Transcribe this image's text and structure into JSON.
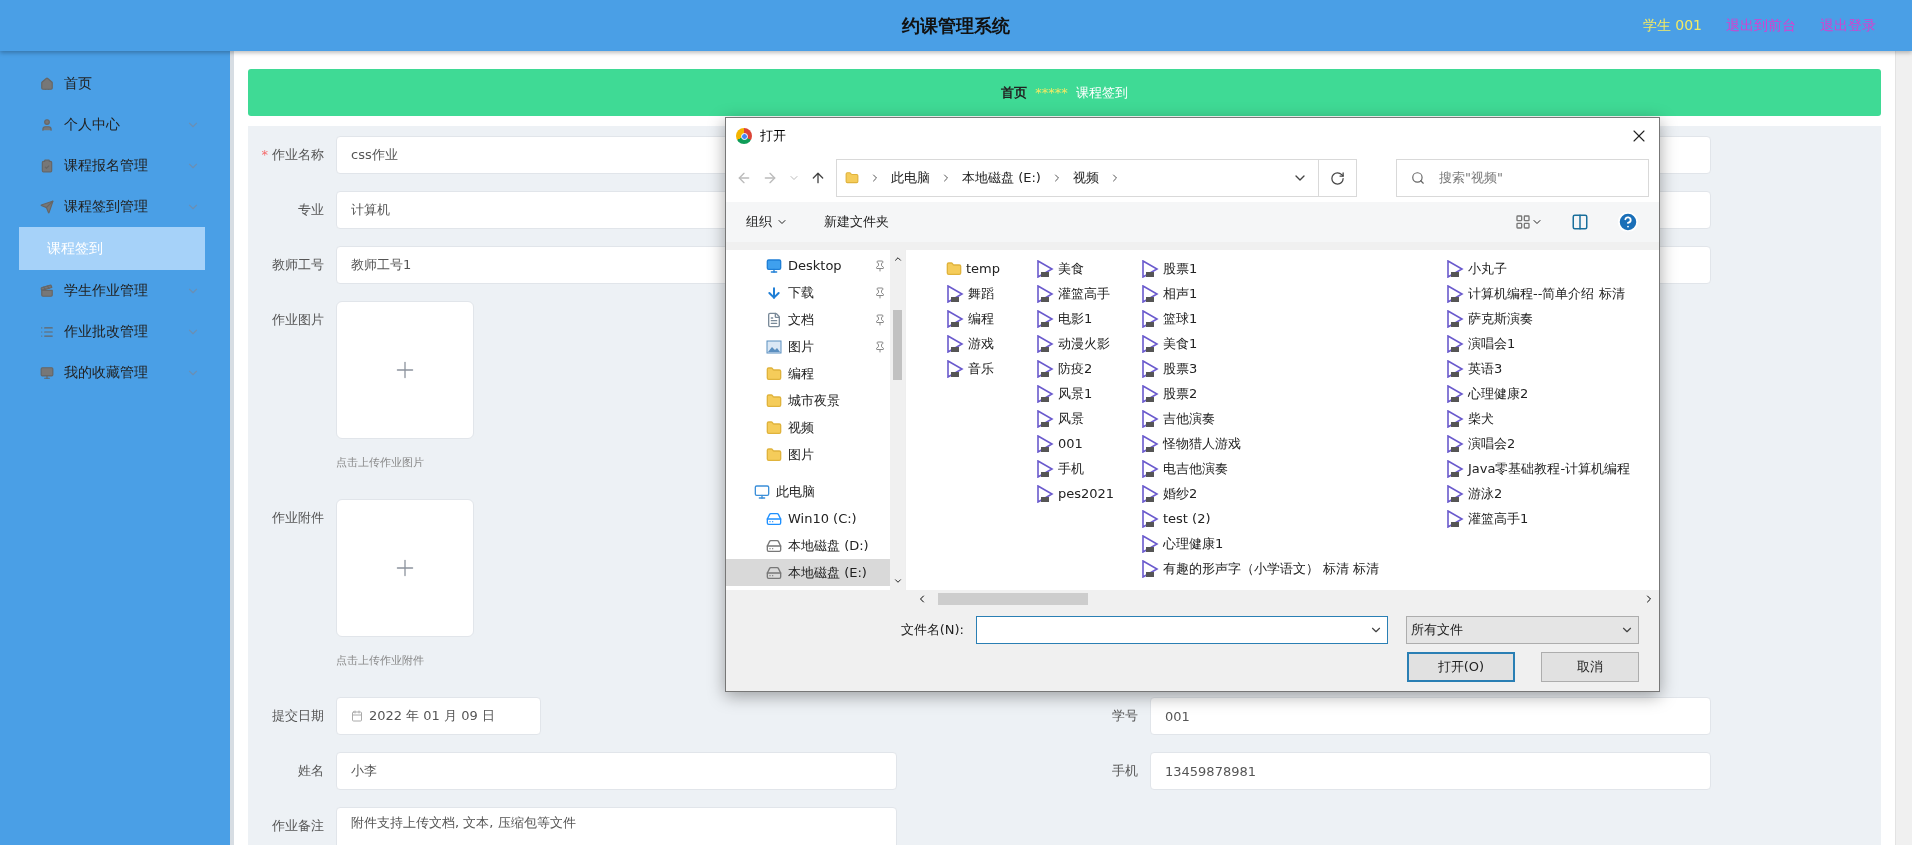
{
  "header": {
    "title": "约课管理系统",
    "user": "学生 001",
    "links": [
      "退出到前台",
      "退出登录"
    ]
  },
  "sidebar": {
    "items": [
      {
        "label": "首页",
        "expandable": false,
        "selected": false
      },
      {
        "label": "个人中心",
        "expandable": true,
        "selected": false
      },
      {
        "label": "课程报名管理",
        "expandable": true,
        "selected": false
      },
      {
        "label": "课程签到管理",
        "expandable": true,
        "selected": false,
        "expanded": true,
        "children": [
          {
            "label": "课程签到",
            "selected": true
          }
        ]
      },
      {
        "label": "学生作业管理",
        "expandable": true,
        "selected": false
      },
      {
        "label": "作业批改管理",
        "expandable": true,
        "selected": false
      },
      {
        "label": "我的收藏管理",
        "expandable": true,
        "selected": false
      }
    ]
  },
  "breadcrumb": {
    "home": "首页",
    "separator": "*****",
    "current": "课程签到"
  },
  "form": {
    "rows": [
      [
        {
          "kind": "input",
          "label": "作业名称",
          "required_mark": "*",
          "value": "css作业"
        },
        {
          "kind": "input"
        }
      ],
      [
        {
          "kind": "input",
          "label": "专业",
          "value": "计算机"
        },
        {
          "kind": "input"
        }
      ],
      [
        {
          "kind": "input",
          "label": "教师工号",
          "value": "教师工号1"
        },
        {
          "kind": "input"
        }
      ],
      [
        {
          "kind": "upload",
          "label": "作业图片",
          "hint": "点击上传作业图片"
        }
      ],
      [
        {
          "kind": "upload",
          "label": "作业附件",
          "hint": "点击上传作业附件"
        }
      ],
      [
        {
          "kind": "date",
          "label": "提交日期",
          "value": "2022 年 01 月 09 日"
        },
        {
          "kind": "input",
          "label": "学号",
          "value": "001"
        }
      ],
      [
        {
          "kind": "input",
          "label": "姓名",
          "value": "小李"
        },
        {
          "kind": "input",
          "label": "手机",
          "value": "13459878981"
        }
      ],
      [
        {
          "kind": "textarea",
          "label": "作业备注",
          "value": "附件支持上传文档, 文本, 压缩包等文件"
        }
      ]
    ]
  },
  "dialog": {
    "title": "打开",
    "path": [
      "此电脑",
      "本地磁盘 (E:)",
      "视频"
    ],
    "search_placeholder": "搜索\"视频\"",
    "toolbar": {
      "organize": "组织",
      "new_folder": "新建文件夹"
    },
    "nav": [
      {
        "label": "Desktop",
        "kind": "desktop",
        "pinned": true,
        "selected": false
      },
      {
        "label": "下载",
        "kind": "download",
        "pinned": true,
        "selected": false
      },
      {
        "label": "文档",
        "kind": "document",
        "pinned": true,
        "selected": false
      },
      {
        "label": "图片",
        "kind": "pictures",
        "pinned": true,
        "selected": false
      },
      {
        "label": "编程",
        "kind": "folder",
        "pinned": false,
        "selected": false
      },
      {
        "label": "城市夜景",
        "kind": "folder",
        "pinned": false,
        "selected": false
      },
      {
        "label": "视频",
        "kind": "folder",
        "pinned": false,
        "selected": false
      },
      {
        "label": "图片",
        "kind": "folder",
        "pinned": false,
        "selected": false
      },
      {
        "label": "此电脑",
        "kind": "pc",
        "pinned": false,
        "selected": false,
        "children": [
          {
            "label": "Win10 (C:)",
            "kind": "system-drive",
            "pinned": false,
            "selected": false
          },
          {
            "label": "本地磁盘 (D:)",
            "kind": "drive",
            "pinned": false,
            "selected": false
          },
          {
            "label": "本地磁盘 (E:)",
            "kind": "drive",
            "pinned": false,
            "selected": true
          }
        ]
      }
    ],
    "file_columns": [
      {
        "items": [
          {
            "name": "temp",
            "kind": "folder"
          },
          {
            "name": "舞蹈",
            "kind": "video"
          },
          {
            "name": "编程",
            "kind": "video"
          },
          {
            "name": "游戏",
            "kind": "video"
          },
          {
            "name": "音乐",
            "kind": "video"
          }
        ]
      },
      {
        "items": [
          {
            "name": "美食",
            "kind": "video"
          },
          {
            "name": "灌篮高手",
            "kind": "video"
          },
          {
            "name": "电影1",
            "kind": "video"
          },
          {
            "name": "动漫火影",
            "kind": "video"
          },
          {
            "name": "防疫2",
            "kind": "video"
          },
          {
            "name": "风景1",
            "kind": "video"
          },
          {
            "name": "风景",
            "kind": "video"
          },
          {
            "name": "001",
            "kind": "video"
          },
          {
            "name": "手机",
            "kind": "video"
          },
          {
            "name": "pes2021",
            "kind": "video"
          }
        ]
      },
      {
        "items": [
          {
            "name": "股票1",
            "kind": "video"
          },
          {
            "name": "相声1",
            "kind": "video"
          },
          {
            "name": "篮球1",
            "kind": "video"
          },
          {
            "name": "美食1",
            "kind": "video"
          },
          {
            "name": "股票3",
            "kind": "video"
          },
          {
            "name": "股票2",
            "kind": "video"
          },
          {
            "name": "吉他演奏",
            "kind": "video"
          },
          {
            "name": "怪物猎人游戏",
            "kind": "video"
          },
          {
            "name": "电吉他演奏",
            "kind": "video"
          },
          {
            "name": "婚纱2",
            "kind": "video"
          },
          {
            "name": "test (2)",
            "kind": "video"
          },
          {
            "name": "心理健康1",
            "kind": "video"
          },
          {
            "name": "有趣的形声字（小学语文）  标清  标清",
            "kind": "video"
          }
        ]
      },
      {
        "items": [
          {
            "name": "小丸子",
            "kind": "video"
          },
          {
            "name": "计算机编程--简单介绍  标清",
            "kind": "video"
          },
          {
            "name": "萨克斯演奏",
            "kind": "video"
          },
          {
            "name": "演唱会1",
            "kind": "video"
          },
          {
            "name": "英语3",
            "kind": "video"
          },
          {
            "name": "心理健康2",
            "kind": "video"
          },
          {
            "name": "柴犬",
            "kind": "video"
          },
          {
            "name": "演唱会2",
            "kind": "video"
          },
          {
            "name": "Java零基础教程-计算机编程",
            "kind": "video"
          },
          {
            "name": "游泳2",
            "kind": "video"
          },
          {
            "name": "灌篮高手1",
            "kind": "video"
          }
        ]
      }
    ],
    "filename_label": "文件名(N):",
    "filter": "所有文件",
    "buttons": {
      "open": "打开(O)",
      "cancel": "取消"
    }
  }
}
